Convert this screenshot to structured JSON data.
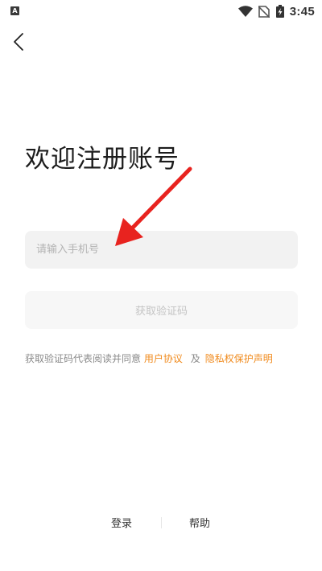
{
  "status_bar": {
    "app_badge": "A",
    "time": "3:45",
    "icons": [
      "notification-a-icon",
      "wifi-icon",
      "no-sim-icon",
      "battery-charging-icon"
    ]
  },
  "nav": {
    "back_icon": "chevron-left-icon"
  },
  "title": "欢迎注册账号",
  "phone": {
    "placeholder": "请输入手机号",
    "value": ""
  },
  "get_code_button": "获取验证码",
  "agreement": {
    "prefix": "获取验证码代表阅读并同意",
    "user_agreement": "用户协议",
    "conjunction": "及",
    "privacy_policy": "隐私权保护声明"
  },
  "bottom": {
    "login": "登录",
    "help": "帮助"
  },
  "colors": {
    "link": "#f08a1c",
    "input_bg": "#f2f2f2",
    "button_bg": "#f7f7f7",
    "annotation": "#e8231f"
  },
  "annotation": {
    "type": "arrow",
    "points_to": "phone-input"
  }
}
